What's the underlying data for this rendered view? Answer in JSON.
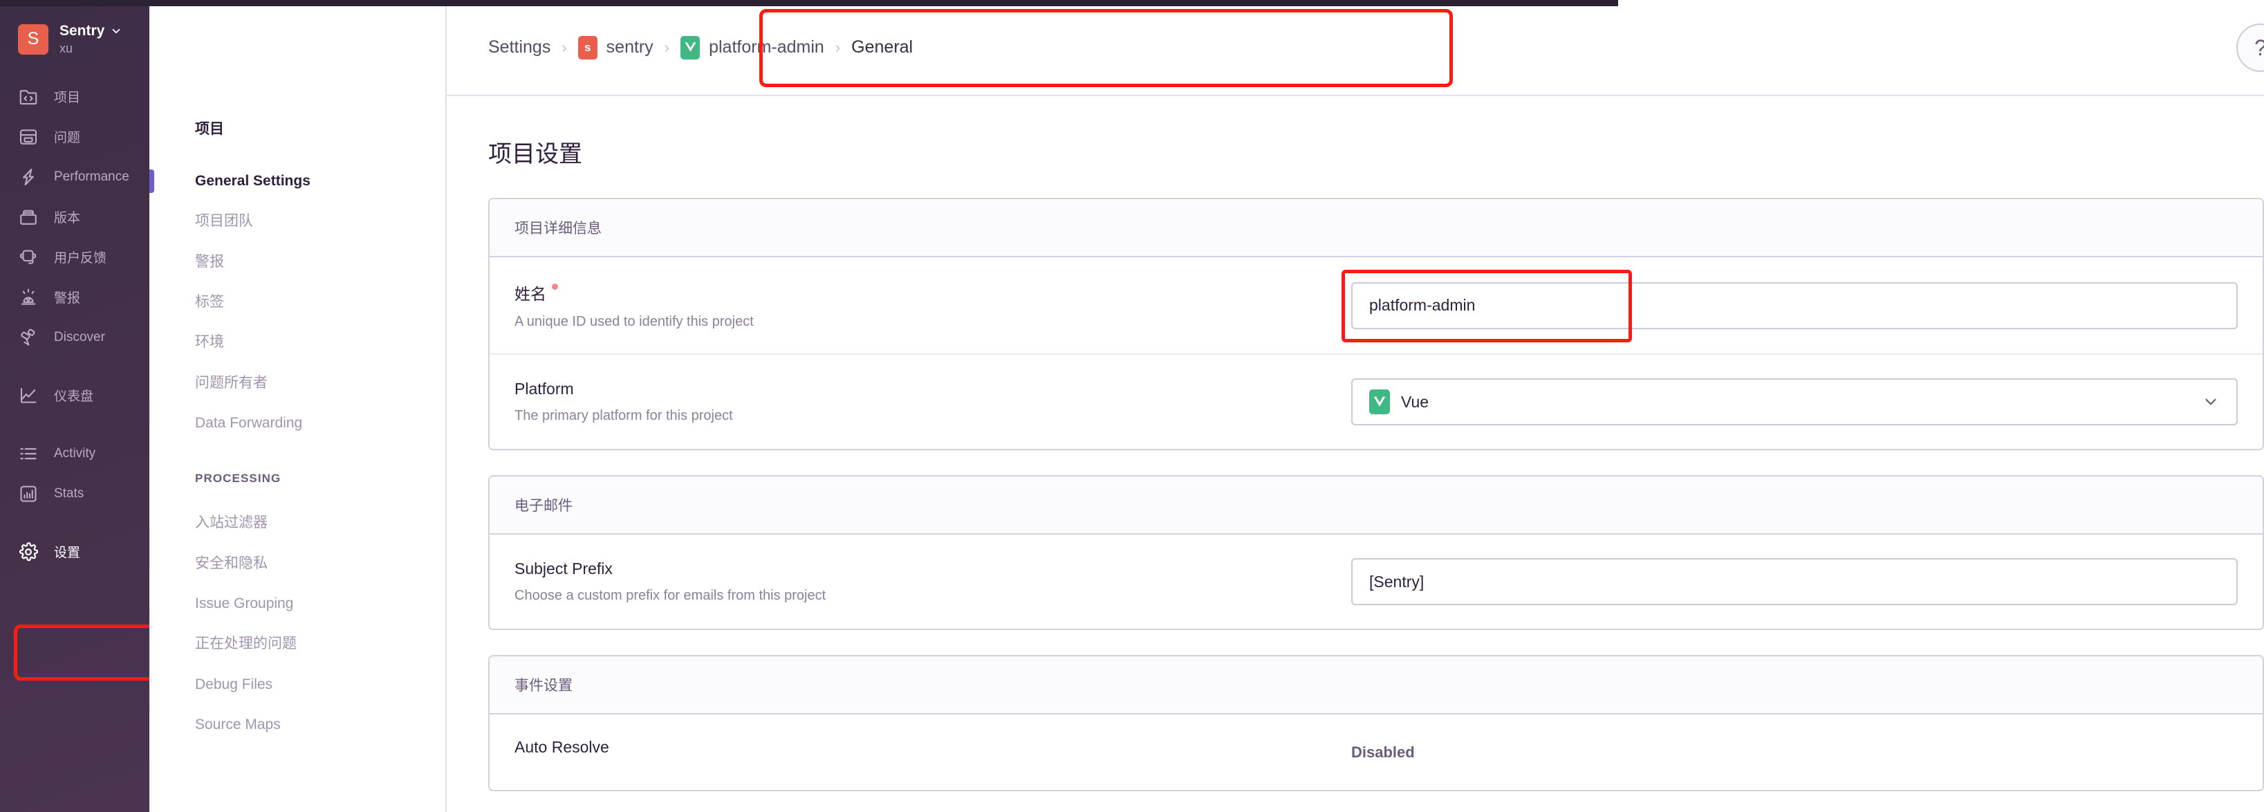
{
  "org": {
    "avatar_letter": "S",
    "name": "Sentry",
    "subtitle": "xu",
    "chevron_icon": "chevron-down-icon"
  },
  "primary_nav": {
    "items": [
      {
        "label": "项目",
        "icon": "projects-folder-code-icon"
      },
      {
        "label": "问题",
        "icon": "issues-inbox-icon"
      },
      {
        "label": "Performance",
        "icon": "performance-lightning-icon"
      },
      {
        "label": "版本",
        "icon": "releases-package-icon"
      },
      {
        "label": "用户反馈",
        "icon": "user-feedback-headset-icon"
      },
      {
        "label": "警报",
        "icon": "alerts-siren-icon"
      },
      {
        "label": "Discover",
        "icon": "discover-telescope-icon"
      },
      {
        "label": "仪表盘",
        "icon": "dashboards-chart-icon"
      },
      {
        "label": "Activity",
        "icon": "activity-list-icon"
      },
      {
        "label": "Stats",
        "icon": "stats-bars-icon"
      }
    ],
    "settings": {
      "label": "设置",
      "icon": "gear-icon"
    }
  },
  "breadcrumb": {
    "settings_label": "Settings",
    "org_badge_letter": "s",
    "org_label": "sentry",
    "project_label": "platform-admin",
    "page_label": "General",
    "separator": "›",
    "help_icon": "question-circle-icon"
  },
  "secondary_nav": {
    "heading": "项目",
    "items": [
      {
        "label": "General Settings",
        "active": true
      },
      {
        "label": "项目团队",
        "active": false
      },
      {
        "label": "警报",
        "active": false
      },
      {
        "label": "标签",
        "active": false
      },
      {
        "label": "环境",
        "active": false
      },
      {
        "label": "问题所有者",
        "active": false
      },
      {
        "label": "Data Forwarding",
        "active": false
      }
    ],
    "processing_heading": "PROCESSING",
    "processing_items": [
      {
        "label": "入站过滤器"
      },
      {
        "label": "安全和隐私"
      },
      {
        "label": "Issue Grouping"
      },
      {
        "label": "正在处理的问题"
      },
      {
        "label": "Debug Files"
      },
      {
        "label": "Source Maps"
      }
    ]
  },
  "main": {
    "page_title": "项目设置",
    "panels": [
      {
        "header": "项目详细信息",
        "rows": [
          {
            "label": "姓名",
            "required": true,
            "help": "A unique ID used to identify this project",
            "control": "text",
            "value": "platform-admin",
            "placeholder": "platform-admin"
          },
          {
            "label": "Platform",
            "required": false,
            "help": "The primary platform for this project",
            "control": "select",
            "value": "Vue",
            "icon": "vue-logo-icon"
          }
        ]
      },
      {
        "header": "电子邮件",
        "rows": [
          {
            "label": "Subject Prefix",
            "required": false,
            "help": "Choose a custom prefix for emails from this project",
            "control": "text",
            "value": "[Sentry]",
            "placeholder": "[Sentry]"
          }
        ]
      },
      {
        "header": "事件设置",
        "rows": [
          {
            "label": "Auto Resolve",
            "required": false,
            "help": "",
            "control": "status",
            "value": "Disabled"
          }
        ]
      }
    ]
  },
  "annotations": {
    "breadcrumb_highlight_color": "#ff1b10",
    "settings_highlight_color": "#ff1b10",
    "name_input_highlight_color": "#ff1b10"
  },
  "colors": {
    "sidebar_bg": "#443049",
    "org_avatar": "#e8604c",
    "vue_green": "#41b883",
    "active_indicator": "#6c5fc7",
    "highlight_red": "#ff1b10"
  }
}
